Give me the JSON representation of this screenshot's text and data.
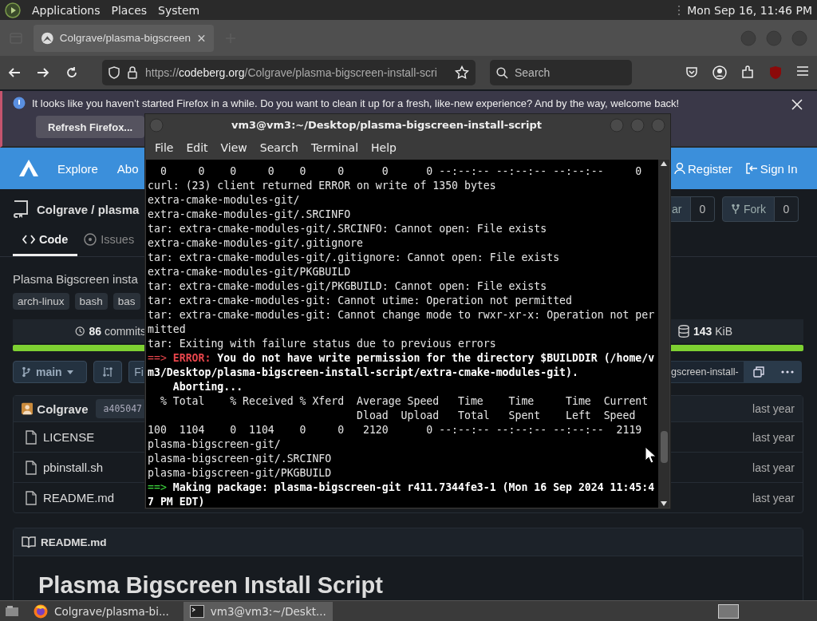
{
  "top_panel": {
    "menus": [
      "Applications",
      "Places",
      "System"
    ],
    "clock": "Mon Sep 16, 11:46 PM"
  },
  "browser": {
    "tab": {
      "title": "Colgrave/plasma-bigscreen"
    },
    "url": {
      "scheme": "https://",
      "host": "codeberg.org",
      "path": "/Colgrave/plasma-bigscreen-install-scri"
    },
    "search": {
      "placeholder": "Search"
    },
    "notification": {
      "message": "It looks like you haven’t started Firefox in a while. Do you want to clean it up for a fresh, like-new experience? And by the way, welcome back!",
      "button": "Refresh Firefox..."
    }
  },
  "site_header": {
    "nav": [
      "Explore",
      "Abo"
    ],
    "register": "Register",
    "sign_in": "Sign In"
  },
  "repo": {
    "title": "Colgrave / plasma",
    "star_label": "ar",
    "star_count": "0",
    "fork_label": "Fork",
    "fork_count": "0",
    "tabs": [
      {
        "label": "Code",
        "selected": true
      },
      {
        "label": "Issues",
        "selected": false
      }
    ],
    "description": "Plasma Bigscreen insta",
    "topics": [
      "arch-linux",
      "bash",
      "bas"
    ],
    "commits": "**86** commits",
    "size": "**143** KiB",
    "branch": "main",
    "find_label": "Fi",
    "clone_url": "gscreen-install-",
    "last_commit": {
      "author": "Colgrave",
      "sha": "a405047",
      "time": "last year"
    },
    "files": [
      {
        "name": "LICENSE",
        "time": "last year"
      },
      {
        "name": "pbinstall.sh",
        "time": "last year"
      },
      {
        "name": "README.md",
        "time": "last year"
      }
    ],
    "readme": {
      "title": "README.md",
      "heading": "Plasma Bigscreen Install Script"
    }
  },
  "terminal": {
    "title": "vm3@vm3:~/Desktop/plasma-bigscreen-install-script",
    "menus": [
      "File",
      "Edit",
      "View",
      "Search",
      "Terminal",
      "Help"
    ],
    "lines": [
      {
        "kind": "plain",
        "text": "  0     0    0     0    0     0      0      0 --:--:-- --:--:-- --:--:--     0"
      },
      {
        "kind": "plain",
        "text": "curl: (23) client returned ERROR on write of 1350 bytes"
      },
      {
        "kind": "plain",
        "text": "extra-cmake-modules-git/"
      },
      {
        "kind": "plain",
        "text": "extra-cmake-modules-git/.SRCINFO"
      },
      {
        "kind": "plain",
        "text": "tar: extra-cmake-modules-git/.SRCINFO: Cannot open: File exists"
      },
      {
        "kind": "plain",
        "text": "extra-cmake-modules-git/.gitignore"
      },
      {
        "kind": "plain",
        "text": "tar: extra-cmake-modules-git/.gitignore: Cannot open: File exists"
      },
      {
        "kind": "plain",
        "text": "extra-cmake-modules-git/PKGBUILD"
      },
      {
        "kind": "plain",
        "text": "tar: extra-cmake-modules-git/PKGBUILD: Cannot open: File exists"
      },
      {
        "kind": "plain",
        "text": "tar: extra-cmake-modules-git: Cannot utime: Operation not permitted"
      },
      {
        "kind": "plain",
        "text": "tar: extra-cmake-modules-git: Cannot change mode to rwxr-xr-x: Operation not per"
      },
      {
        "kind": "plain",
        "text": "mitted"
      },
      {
        "kind": "plain",
        "text": "tar: Exiting with failure status due to previous errors"
      },
      {
        "kind": "error",
        "prefix": "==>",
        "label": "ERROR:",
        "text": "You do not have write permission for the directory $BUILDDIR (/home/v"
      },
      {
        "kind": "bold",
        "text": "m3/Desktop/plasma-bigscreen-install-script/extra-cmake-modules-git)."
      },
      {
        "kind": "bold",
        "text": "    Aborting..."
      },
      {
        "kind": "plain",
        "text": "  % Total    % Received % Xferd  Average Speed   Time    Time     Time  Current"
      },
      {
        "kind": "plain",
        "text": "                                 Dload  Upload   Total   Spent    Left  Speed"
      },
      {
        "kind": "plain",
        "text": "100  1104    0  1104    0     0   2120      0 --:--:-- --:--:-- --:--:--  2119"
      },
      {
        "kind": "plain",
        "text": "plasma-bigscreen-git/"
      },
      {
        "kind": "plain",
        "text": "plasma-bigscreen-git/.SRCINFO"
      },
      {
        "kind": "plain",
        "text": "plasma-bigscreen-git/PKGBUILD"
      },
      {
        "kind": "make",
        "prefix": "==>",
        "text": "Making package: plasma-bigscreen-git r411.7344fe3-1 (Mon 16 Sep 2024 11:45:4"
      },
      {
        "kind": "bold",
        "text": "7 PM EDT)"
      }
    ]
  },
  "taskbar": {
    "tasks": [
      {
        "kind": "browser",
        "label": "Colgrave/plasma-bi...",
        "selected": false
      },
      {
        "kind": "terminal",
        "label": "vm3@vm3:~/Deskt...",
        "selected": true
      }
    ]
  }
}
